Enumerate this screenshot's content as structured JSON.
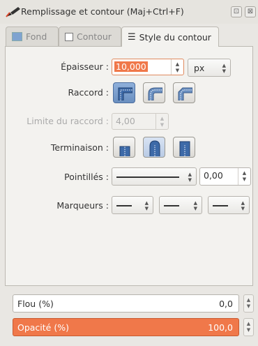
{
  "window": {
    "title": "Remplissage et contour (Maj+Ctrl+F)",
    "restore_glyph": "⊡",
    "close_glyph": "⊠"
  },
  "tabs": [
    {
      "label": "Fond",
      "icon": "fill-swatch-icon",
      "active": false
    },
    {
      "label": "Contour",
      "icon": "stroke-box-icon",
      "active": false
    },
    {
      "label": "Style du contour",
      "icon": "stroke-style-icon",
      "active": true
    }
  ],
  "stroke_style": {
    "width": {
      "label": "Épaisseur :",
      "value": "10,000",
      "unit": "px"
    },
    "join": {
      "label": "Raccord :",
      "options": [
        "miter-join-icon",
        "round-join-icon",
        "bevel-join-icon"
      ]
    },
    "miter_limit": {
      "label": "Limite du raccord :",
      "value": "4,00"
    },
    "cap": {
      "label": "Terminaison :",
      "options": [
        "butt-cap-icon",
        "round-cap-icon",
        "square-cap-icon"
      ]
    },
    "dashes": {
      "label": "Pointillés :",
      "offset": "0,00"
    },
    "markers": {
      "label": "Marqueurs :"
    }
  },
  "bottom": {
    "blur": {
      "label": "Flou (%)",
      "value": "0,0"
    },
    "opacity": {
      "label": "Opacité (%)",
      "value": "100,0"
    }
  },
  "colors": {
    "accent": "#f0784a",
    "button_blue": "#6a8fc0"
  }
}
